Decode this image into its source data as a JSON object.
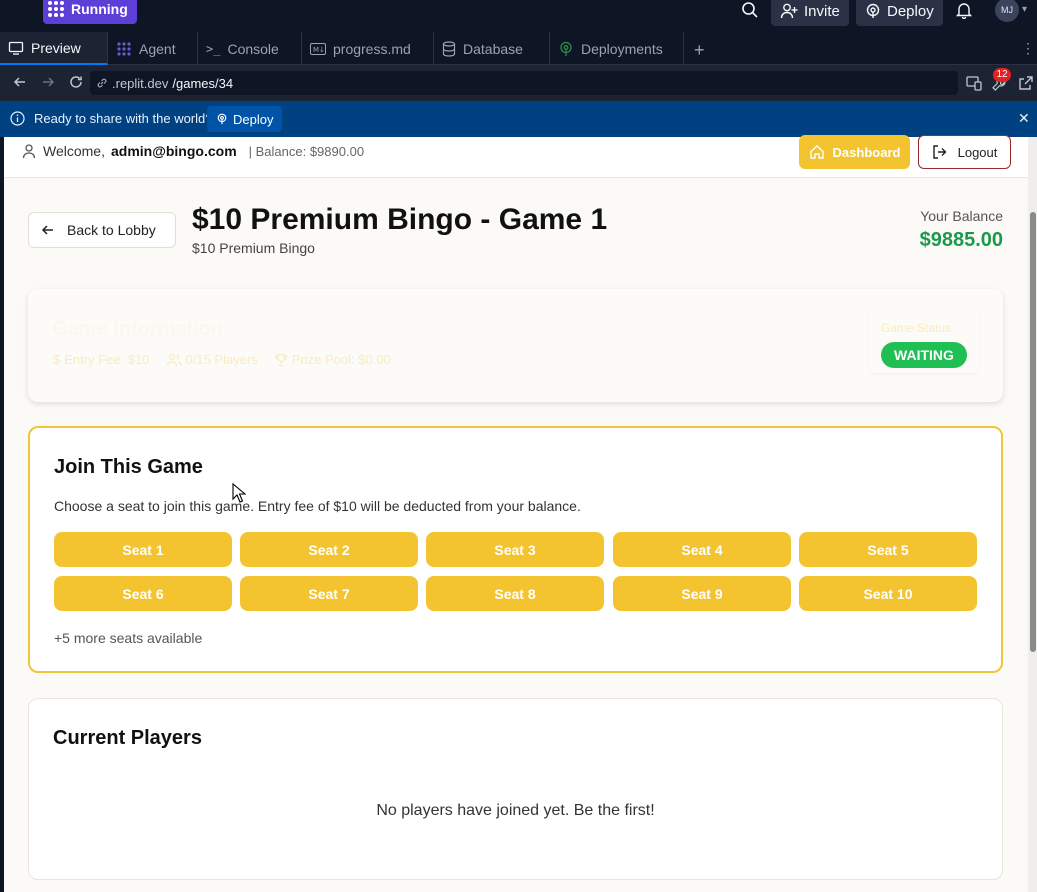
{
  "topbar": {
    "status": "Running",
    "invite_label": "Invite",
    "deploy_label": "Deploy",
    "avatar_initials": "MJ"
  },
  "tabs": [
    {
      "label": "Preview"
    },
    {
      "label": "Agent"
    },
    {
      "label": "Console"
    },
    {
      "label": "progress.md"
    },
    {
      "label": "Database"
    },
    {
      "label": "Deployments"
    }
  ],
  "urlbar": {
    "domain": ".replit.dev",
    "path": "/games/34",
    "notification_count": "12"
  },
  "banner": {
    "text": "Ready to share with the world?",
    "button_label": "Deploy"
  },
  "header": {
    "welcome_label": "Welcome,",
    "user_email": "admin@bingo.com",
    "balance_text": "| Balance: $9890.00",
    "dashboard_label": "Dashboard",
    "logout_label": "Logout"
  },
  "game": {
    "back_label": "Back to Lobby",
    "title": "$10 Premium Bingo - Game 1",
    "subtitle": "$10 Premium Bingo",
    "balance_label": "Your Balance",
    "balance_value": "$9885.00"
  },
  "info": {
    "title": "Game Information",
    "entry_fee": "Entry Fee: $10",
    "players": "0/15 Players",
    "prize_pool": "Prize Pool: $0.00",
    "status_label": "Game Status",
    "status_value": "WAITING"
  },
  "join": {
    "title": "Join This Game",
    "description": "Choose a seat to join this game. Entry fee of $10 will be deducted from your balance.",
    "seats": [
      "Seat 1",
      "Seat 2",
      "Seat 3",
      "Seat 4",
      "Seat 5",
      "Seat 6",
      "Seat 7",
      "Seat 8",
      "Seat 9",
      "Seat 10"
    ],
    "more_text": "+5 more seats available"
  },
  "players": {
    "title": "Current Players",
    "empty_text": "No players have joined yet. Be the first!"
  },
  "colors": {
    "accent_yellow": "#f4c430",
    "status_green": "#1fbf54",
    "balance_green": "#1a9a4c",
    "replit_blue": "#004182"
  }
}
